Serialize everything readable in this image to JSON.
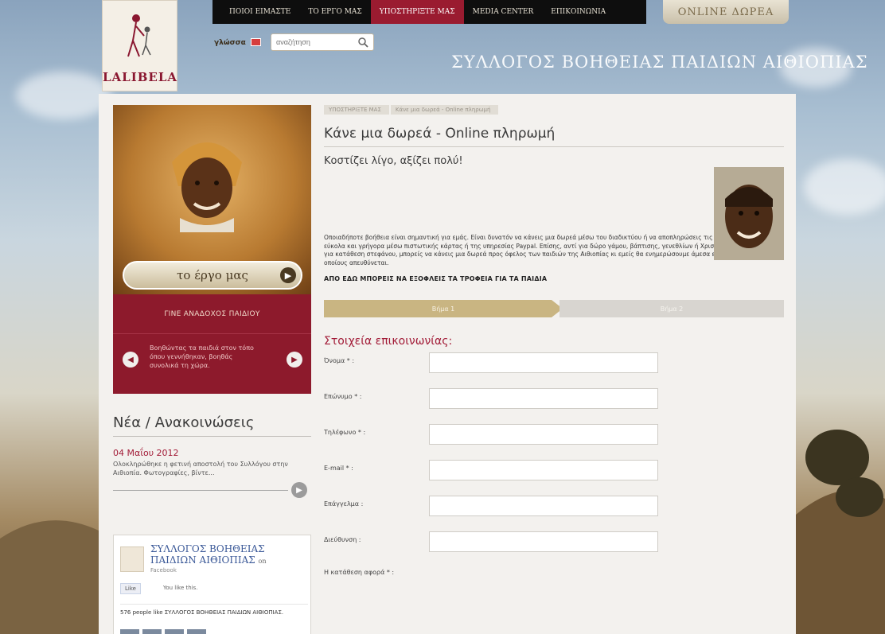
{
  "header": {
    "logo_text": "LALIBELA",
    "nav": [
      {
        "label": "ΠΟΙΟΙ ΕΙΜΑΣΤΕ",
        "active": false
      },
      {
        "label": "ΤΟ ΕΡΓΟ ΜΑΣ",
        "active": false
      },
      {
        "label": "ΥΠΟΣΤΗΡΙΞΤΕ ΜΑΣ",
        "active": true
      },
      {
        "label": "MEDIA CENTER",
        "active": false
      },
      {
        "label": "ΕΠΙΚΟΙΝΩΝΙΑ",
        "active": false
      }
    ],
    "donate_label": "ONLINE ΔΩΡΕΑ",
    "language_label": "γλώσσα",
    "search_placeholder": "αναζήτηση",
    "site_title": "ΣΥΛΛΟΓΟΣ ΒΟΗΘΕΙΑΣ ΠΑΙΔΙΩΝ ΑΙΘΙΟΠΙΑΣ"
  },
  "sidebar": {
    "project_button": "το έργο μας",
    "adopt_title": "ΓΙΝΕ ΑΝΑΔΟΧΟΣ ΠΑΙΔΙΟΥ",
    "adopt_text": "Βοηθώντας τα παιδιά στον τόπο όπου γεννήθηκαν, βοηθάς συνολικά τη χώρα.",
    "news_title": "Νέα / Ανακοινώσεις",
    "news_date": "04 Μαΐου 2012",
    "news_text": "Ολοκληρώθηκε η φετινή αποστολή του Συλλόγου στην Αιθιοπία. Φωτογραφίες, βίντε...",
    "facebook": {
      "page_name": "ΣΥΛΛΟΓΟΣ ΒΟΗΘΕΙΑΣ ΠΑΙΔΙΩΝ ΑΙΘΙΟΠΙΑΣ",
      "on_label": "on",
      "platform": "Facebook",
      "like_button": "Like",
      "like_text": "You like this.",
      "count_text": "576 people like ΣΥΛΛΟΓΟΣ ΒΟΗΘΕΙΑΣ ΠΑΙΔΙΩΝ ΑΙΘΙΟΠΙΑΣ."
    }
  },
  "main": {
    "breadcrumb": [
      "ΥΠΟΣΤΗΡΙΞΤΕ ΜΑΣ",
      "Κάνε μια δωρεά - Online πληρωμή"
    ],
    "page_title": "Κάνε μια δωρεά - Online πληρωμή",
    "subtitle": "Κοστίζει λίγο, αξίζει πολύ!",
    "intro": "Οποιαδήποτε βοήθεια είναι σημαντική για εμάς. Είναι δυνατόν να κάνεις μια δωρεά μέσω του διαδικτύου ή να αποπληρώσεις τις υποχρεώσεις σου εύκολα και γρήγορα μέσω πιστωτικής κάρτας ή της υπηρεσίας Paypal. Επίσης, αντί για δώρο γάμου, βάπτισης, γενεθλίων ή Χριστουγέννων ή και αντί για κατάθεση στεφάνου, μπορείς να κάνεις μια δωρεά προς όφελος των παιδιών της Αιθιοπίας κι εμείς θα ενημερώσουμε άμεσα εκείνον/ους στους οποίους απευθύνεται.",
    "bold_line": "ΑΠΟ ΕΔΩ ΜΠΟΡΕΙΣ ΝΑ ΕΞΟΦΛΕΙΣ ΤΑ ΤΡΟΦΕΙΑ ΓΙΑ ΤΑ ΠΑΙΔΙΑ",
    "steps": [
      "Βήμα 1",
      "Βήμα 2"
    ],
    "form_title": "Στοιχεία επικοινωνίας:",
    "fields": [
      {
        "label": "Όνομα * :",
        "value": ""
      },
      {
        "label": "Επώνυμο * :",
        "value": ""
      },
      {
        "label": "Τηλέφωνο * :",
        "value": ""
      },
      {
        "label": "E-mail * :",
        "value": ""
      },
      {
        "label": "Επάγγελμα :",
        "value": ""
      },
      {
        "label": "Διεύθυνση :",
        "value": ""
      }
    ],
    "last_field_label": "Η κατάθεση αφορά * :"
  },
  "colors": {
    "brand_red": "#9a1b30",
    "accent_gold": "#c9b582"
  }
}
